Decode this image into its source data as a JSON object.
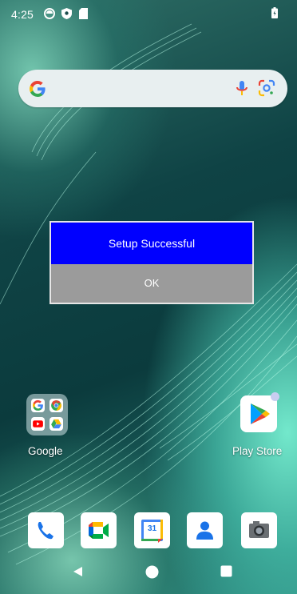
{
  "status_bar": {
    "time": "4:25",
    "icons": [
      "sync-icon",
      "shield-icon",
      "sd-card-icon",
      "battery-icon"
    ]
  },
  "search_bar": {
    "icons": [
      "google-g-icon",
      "microphone-icon",
      "google-lens-icon"
    ]
  },
  "dialog": {
    "title": "Setup Successful",
    "ok_label": "OK",
    "colors": {
      "title_bg": "#0000ff",
      "button_bg": "#9b9b9b"
    }
  },
  "home": {
    "folder": {
      "label": "Google",
      "apps": [
        "google-icon",
        "chrome-icon",
        "youtube-icon",
        "drive-icon"
      ]
    },
    "play_store": {
      "label": "Play Store"
    }
  },
  "dock": [
    "phone-icon",
    "meet-icon",
    "calendar-icon",
    "contacts-icon",
    "camera-icon"
  ],
  "calendar_day": "31",
  "nav_bar": [
    "back-icon",
    "home-icon",
    "recents-icon"
  ]
}
